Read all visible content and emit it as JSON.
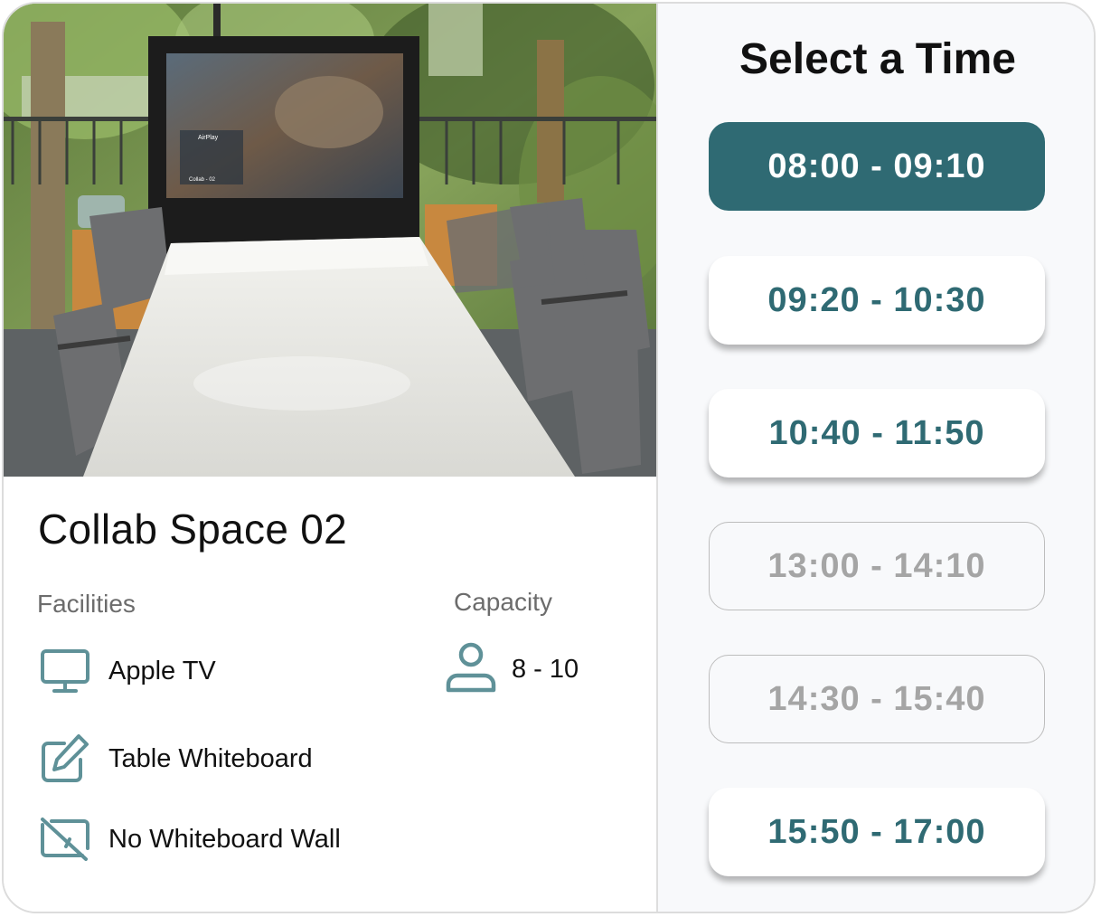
{
  "room": {
    "name": "Collab Space 02",
    "facilities_label": "Facilities",
    "capacity_label": "Capacity",
    "capacity_value": "8 - 10",
    "facilities": [
      {
        "icon": "monitor-icon",
        "label": "Apple TV"
      },
      {
        "icon": "pencil-edit-icon",
        "label": "Table Whiteboard"
      },
      {
        "icon": "no-whiteboard-icon",
        "label": "No Whiteboard Wall"
      }
    ],
    "screen_text": {
      "app": "AirPlay",
      "line": "Collab - 02"
    }
  },
  "schedule": {
    "title": "Select a Time",
    "slots": [
      {
        "label": "08:00 - 09:10",
        "state": "selected"
      },
      {
        "label": "09:20 - 10:30",
        "state": "available"
      },
      {
        "label": "10:40 - 11:50",
        "state": "available"
      },
      {
        "label": "13:00 - 14:10",
        "state": "unavailable"
      },
      {
        "label": "14:30 - 15:40",
        "state": "unavailable"
      },
      {
        "label": "15:50 - 17:00",
        "state": "available"
      }
    ]
  },
  "colors": {
    "accent": "#2f6a73",
    "icon": "#5f9198",
    "disabled_text": "#a5a5a5",
    "panel_bg": "#f8f9fb"
  }
}
